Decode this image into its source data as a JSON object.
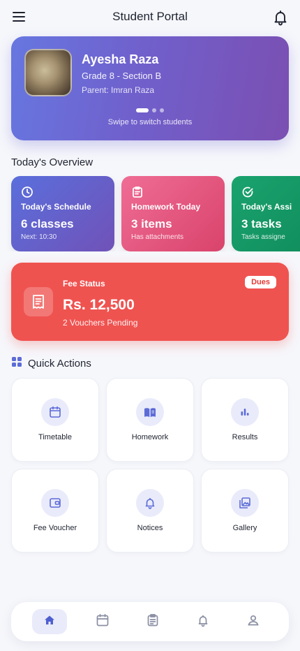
{
  "header": {
    "title": "Student Portal",
    "menu_icon": "hamburger-menu-icon",
    "notifications_icon": "bell-icon"
  },
  "student": {
    "name": "Ayesha Raza",
    "grade": "Grade 8 - Section B",
    "parent": "Parent: Imran Raza",
    "swipe_hint": "Swipe to switch students",
    "pager": {
      "count": 3,
      "active": 1
    }
  },
  "overview": {
    "title": "Today's Overview",
    "cards": [
      {
        "icon": "clock-icon",
        "title": "Today's Schedule",
        "value": "6 classes",
        "sub": "Next: 10:30",
        "color": "#6366d9"
      },
      {
        "icon": "clipboard-icon",
        "title": "Homework Today",
        "value": "3 items",
        "sub": "Has attachments",
        "color": "#e5507e"
      },
      {
        "icon": "check-circle-icon",
        "title": "Today's Assi",
        "value": "3 tasks",
        "sub": "Tasks assigne",
        "color": "#12995f"
      }
    ]
  },
  "fee": {
    "label": "Fee Status",
    "amount": "Rs. 12,500",
    "pending": "2 Vouchers Pending",
    "badge": "Dues",
    "icon": "receipt-icon",
    "color": "#ef5350"
  },
  "quick_actions": {
    "title": "Quick Actions",
    "icon": "grid-icon",
    "items": [
      {
        "label": "Timetable",
        "icon": "calendar-icon"
      },
      {
        "label": "Homework",
        "icon": "book-open-icon"
      },
      {
        "label": "Results",
        "icon": "bar-chart-icon"
      },
      {
        "label": "Fee Voucher",
        "icon": "wallet-icon"
      },
      {
        "label": "Notices",
        "icon": "bell-icon"
      },
      {
        "label": "Gallery",
        "icon": "photo-library-icon"
      }
    ]
  },
  "bottom_nav": {
    "items": [
      {
        "icon": "home-icon",
        "active": true
      },
      {
        "icon": "calendar-icon",
        "active": false
      },
      {
        "icon": "clipboard-icon",
        "active": false
      },
      {
        "icon": "bell-icon",
        "active": false
      },
      {
        "icon": "user-icon",
        "active": false
      }
    ]
  },
  "colors": {
    "accent": "#5c6bd6",
    "background": "#f6f7fb",
    "icon_tint_bg": "#e9ebfb"
  }
}
